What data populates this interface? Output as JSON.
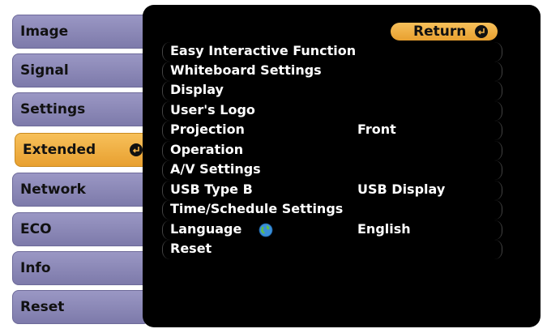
{
  "sidebar": {
    "items": [
      {
        "label": "Image"
      },
      {
        "label": "Signal"
      },
      {
        "label": "Settings"
      },
      {
        "label": "Extended"
      },
      {
        "label": "Network"
      },
      {
        "label": "ECO"
      },
      {
        "label": "Info"
      },
      {
        "label": "Reset"
      }
    ],
    "active_index": 3
  },
  "panel": {
    "return_label": "Return",
    "items": [
      {
        "label": "Easy Interactive Function",
        "value": ""
      },
      {
        "label": "Whiteboard Settings",
        "value": ""
      },
      {
        "label": "Display",
        "value": ""
      },
      {
        "label": "User's Logo",
        "value": ""
      },
      {
        "label": "Projection",
        "value": "Front"
      },
      {
        "label": "Operation",
        "value": ""
      },
      {
        "label": "A/V Settings",
        "value": ""
      },
      {
        "label": "USB Type B",
        "value": "USB Display"
      },
      {
        "label": "Time/Schedule Settings",
        "value": ""
      },
      {
        "label": "Language",
        "value": "English",
        "icon": "globe-icon"
      },
      {
        "label": "Reset",
        "value": ""
      }
    ]
  },
  "colors": {
    "menu_inactive": "#8f8cbd",
    "menu_active": "#f0b040",
    "panel_bg": "#000000",
    "text_on_panel": "#ffffff"
  }
}
